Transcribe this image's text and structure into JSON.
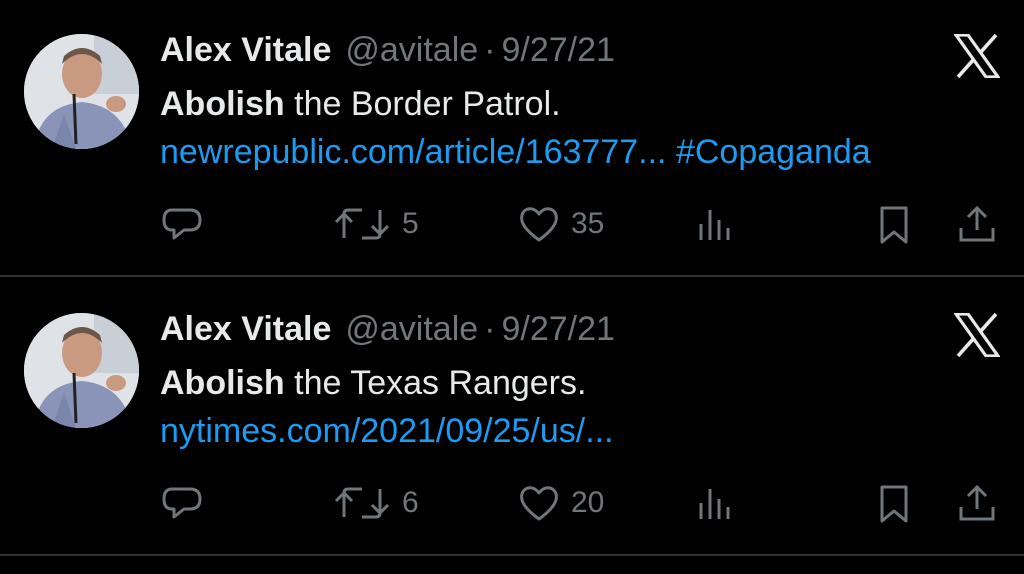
{
  "tweets": [
    {
      "author_name": "Alex Vitale",
      "handle": "@avitale",
      "separator": "·",
      "date": "9/27/21",
      "text_bold": "Abolish",
      "text_plain": " the Border Patrol. ",
      "link_text": "newrepublic.com/article/163777...",
      "hashtag": " #Copaganda",
      "retweets": "5",
      "likes": "35",
      "icons": [
        "x-logo-icon",
        "reply-icon",
        "retweet-icon",
        "heart-icon",
        "views-icon",
        "bookmark-icon",
        "share-icon"
      ]
    },
    {
      "author_name": "Alex Vitale",
      "handle": "@avitale",
      "separator": "·",
      "date": "9/27/21",
      "text_bold": "Abolish",
      "text_plain": " the Texas Rangers. ",
      "link_text": "nytimes.com/2021/09/25/us/...",
      "hashtag": "",
      "retweets": "6",
      "likes": "20",
      "icons": [
        "x-logo-icon",
        "reply-icon",
        "retweet-icon",
        "heart-icon",
        "views-icon",
        "bookmark-icon",
        "share-icon"
      ]
    }
  ],
  "colors": {
    "background": "#000000",
    "text": "#e7e9ea",
    "muted": "#71767b",
    "link": "#1d9bf0",
    "divider": "#2f3336"
  }
}
